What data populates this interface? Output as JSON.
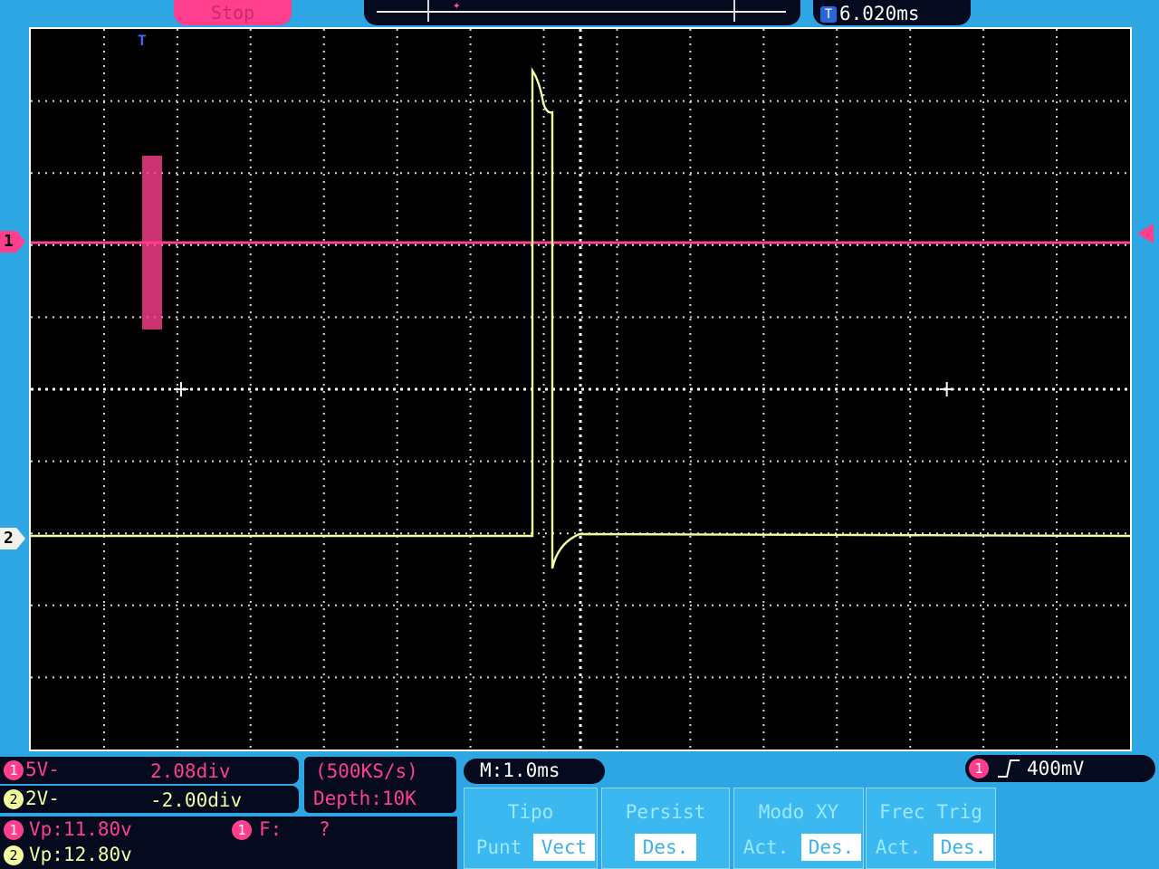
{
  "status": {
    "run_state": "Stop"
  },
  "trigger": {
    "time_offset": "6.020ms",
    "t_label": "T",
    "level": "400mV",
    "source": "1"
  },
  "channels": [
    {
      "id": "1",
      "marker": "1",
      "color": "#ff3f8e"
    },
    {
      "id": "2",
      "marker": "2",
      "color": "#f2ffa0"
    }
  ],
  "info": {
    "ch1_scale": "5V-",
    "ch1_pos": "2.08div",
    "ch2_scale": "2V-",
    "ch2_pos": "-2.00div",
    "ch1_vp": "Vp:11.80v",
    "ch2_vp": "Vp:12.80v",
    "ch1_freq_label": "F:",
    "ch1_freq_value": "?",
    "sample_rate": "(500KS/s)",
    "depth": "Depth:10K",
    "timebase": "M:1.0ms"
  },
  "menu": [
    {
      "title": "Tipo",
      "options": [
        "Punt",
        "Vect"
      ],
      "selected": 1
    },
    {
      "title": "Persist",
      "options": [
        "Des."
      ],
      "selected": 0
    },
    {
      "title": "Modo XY",
      "options": [
        "Act.",
        "Des."
      ],
      "selected": 1
    },
    {
      "title": "Frec Trig",
      "options": [
        "Act.",
        "Des."
      ],
      "selected": 1
    }
  ],
  "colors": {
    "background": "#2fa6e4",
    "screen": "#000000",
    "ch1": "#ff3f8e",
    "ch2": "#f2ffa0",
    "grid": "#d8d8d8"
  }
}
